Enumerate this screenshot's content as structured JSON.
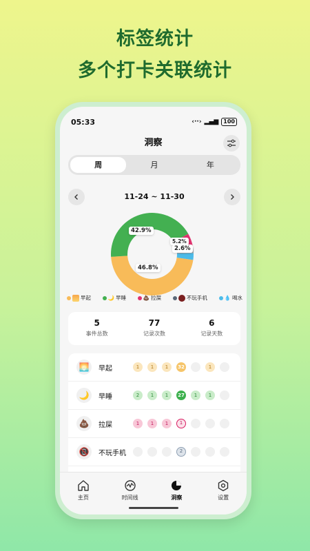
{
  "headline": {
    "line1": "标签统计",
    "line2": "多个打卡关联统计"
  },
  "status": {
    "time": "05:33",
    "battery": "100"
  },
  "header": {
    "title": "洞察"
  },
  "segment": {
    "items": [
      "周",
      "月",
      "年"
    ],
    "active": "周"
  },
  "date_range": "11-24 ~ 11-30",
  "chart_data": {
    "type": "pie",
    "categories": [
      "早起",
      "早睡",
      "拉屎",
      "不玩手机",
      "喝水"
    ],
    "values": [
      46.8,
      42.9,
      5.2,
      2.6,
      2.6
    ],
    "labels": [
      "46.8%",
      "42.9%",
      "5.2%",
      "2.6%"
    ],
    "colors": [
      "#f8bb59",
      "#43b051",
      "#e0336f",
      "#9aa2a8",
      "#4dbbe8"
    ]
  },
  "legend": [
    {
      "label": "早起",
      "color": "#f8bb59",
      "icon": "sunrise-emoji"
    },
    {
      "label": "早睡",
      "color": "#43b051",
      "icon": "moon-emoji"
    },
    {
      "label": "拉屎",
      "color": "#e0336f",
      "icon": "poop-emoji"
    },
    {
      "label": "不玩手机",
      "color": "#5b6878",
      "icon": "no-phone-emoji"
    },
    {
      "label": "喝水",
      "color": "#4dbbe8",
      "icon": "droplet-emoji"
    }
  ],
  "stats": [
    {
      "value": "5",
      "label": "事件总数"
    },
    {
      "value": "77",
      "label": "记录次数"
    },
    {
      "value": "6",
      "label": "记录天数"
    }
  ],
  "habits": [
    {
      "name": "早起",
      "icon": "🌅",
      "days": [
        "1",
        "1",
        "1",
        "32",
        "",
        "1",
        ""
      ],
      "styles": [
        "y",
        "y",
        "y",
        "yb",
        "",
        "y",
        ""
      ]
    },
    {
      "name": "早睡",
      "icon": "🌙",
      "days": [
        "2",
        "1",
        "1",
        "27",
        "1",
        "1",
        ""
      ],
      "styles": [
        "g",
        "g",
        "g",
        "gb",
        "g",
        "g",
        ""
      ]
    },
    {
      "name": "拉屎",
      "icon": "💩",
      "days": [
        "1",
        "1",
        "1",
        "1",
        "",
        "",
        ""
      ],
      "styles": [
        "p",
        "p",
        "p",
        "pr",
        "",
        "",
        ""
      ]
    },
    {
      "name": "不玩手机",
      "icon": "📵",
      "days": [
        "",
        "",
        "",
        "2",
        "",
        "",
        ""
      ],
      "styles": [
        "",
        "",
        "",
        "br",
        "",
        "",
        ""
      ]
    }
  ],
  "tabs": [
    {
      "label": "主页",
      "icon": "home-icon"
    },
    {
      "label": "时间线",
      "icon": "timeline-icon"
    },
    {
      "label": "洞察",
      "icon": "insight-icon"
    },
    {
      "label": "设置",
      "icon": "settings-icon"
    }
  ]
}
